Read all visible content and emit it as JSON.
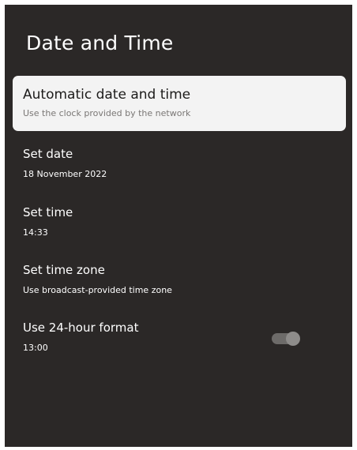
{
  "page": {
    "title": "Date and Time"
  },
  "settings": [
    {
      "title": "Automatic date and time",
      "subtitle": "Use the clock provided by the network",
      "focused": true
    },
    {
      "title": "Set date",
      "subtitle": "18 November 2022"
    },
    {
      "title": "Set time",
      "subtitle": "14:33"
    },
    {
      "title": "Set time zone",
      "subtitle": "Use broadcast-provided time zone"
    },
    {
      "title": "Use 24-hour format",
      "subtitle": "13:00",
      "toggle": "disabled"
    }
  ],
  "colors": {
    "background": "#2b2827",
    "focused_card": "#f3f3f3",
    "text_primary": "#ffffff",
    "toggle_track": "#6d6b69",
    "toggle_thumb": "#8e8c8a"
  }
}
